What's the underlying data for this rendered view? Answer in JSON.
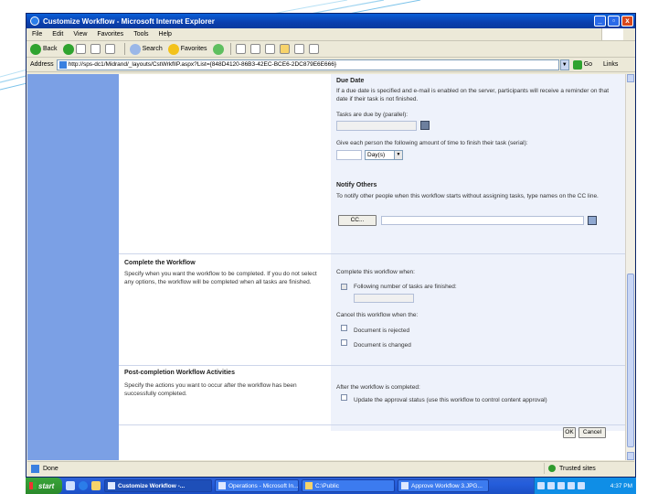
{
  "window": {
    "title": "Customize Workflow - Microsoft Internet Explorer",
    "min_label": "_",
    "max_label": "▫",
    "close_label": "x"
  },
  "menu": [
    "File",
    "Edit",
    "View",
    "Favorites",
    "Tools",
    "Help"
  ],
  "toolbar": {
    "back": "Back",
    "search": "Search",
    "favorites": "Favorites"
  },
  "address": {
    "label": "Address",
    "url": "http://sps-dc1/Midrand/_layouts/CstWrkflIP.aspx?List={848D4120-86B3-42EC-BCE6-2DC879E6E666}",
    "go": "Go",
    "links": "Links"
  },
  "due_date": {
    "heading": "Due Date",
    "description": "If a due date is specified and e-mail is enabled on the server, participants will receive a reminder on that date if their task is not finished.",
    "tasks_due_label": "Tasks are due by (parallel):",
    "serial_label": "Give each person the following amount of time to finish their task (serial):",
    "unit_value": "Day(s)"
  },
  "notify": {
    "heading": "Notify Others",
    "description": "To notify other people when this workflow starts without assigning tasks, type names on the CC line.",
    "cc_button": "CC..."
  },
  "complete": {
    "heading": "Complete the Workflow",
    "description": "Specify when you want the workflow to be completed. If you do not select any options, the workflow will be completed when all tasks are finished.",
    "when_label": "Complete this workflow when:",
    "option_tasks": "Following number of tasks are finished:",
    "cancel_label": "Cancel this workflow when the:",
    "option_rejected": "Document is rejected",
    "option_changed": "Document is changed"
  },
  "post": {
    "heading": "Post-completion Workflow Activities",
    "description": "Specify the actions you want to occur after the workflow has been successfully completed.",
    "after_label": "After the workflow is completed:",
    "option_update": "Update the approval status (use this workflow to control content approval)"
  },
  "buttons": {
    "ok": "OK",
    "cancel": "Cancel"
  },
  "status": {
    "text": "Done",
    "zone": "Trusted sites"
  },
  "taskbar": {
    "start": "start",
    "tasks": [
      "Customize Workflow -...",
      "Operations - Microsoft In...",
      "C:\\Public",
      "Approve Workflow 3.JPG..."
    ],
    "clock": "4:37 PM"
  }
}
